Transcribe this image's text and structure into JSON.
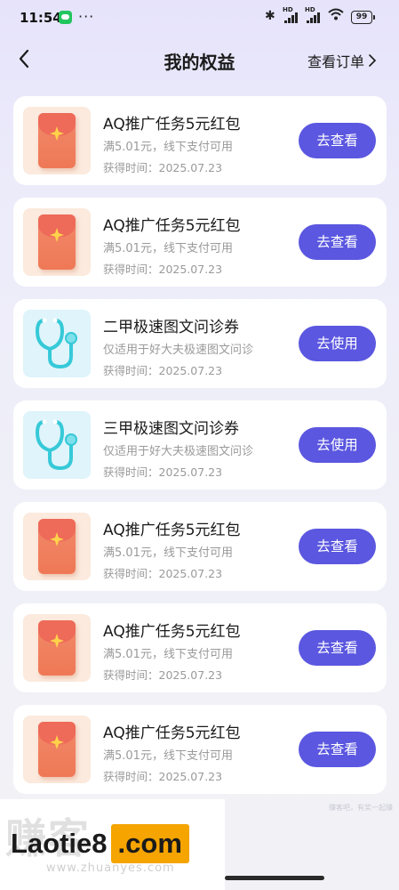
{
  "status_bar": {
    "time": "11:54",
    "dots": "···",
    "hd_label": "HD",
    "battery": "99"
  },
  "header": {
    "title": "我的权益",
    "orders_link": "查看订单"
  },
  "items": [
    {
      "name": "AQ推广任务5元红包",
      "desc": "满5.01元，线下支付可用",
      "date": "获得时间：2025.07.23",
      "button": "去查看",
      "icon": "red-envelope-icon"
    },
    {
      "name": "AQ推广任务5元红包",
      "desc": "满5.01元，线下支付可用",
      "date": "获得时间：2025.07.23",
      "button": "去查看",
      "icon": "red-envelope-icon"
    },
    {
      "name": "二甲极速图文问诊券",
      "desc": "仅适用于好大夫极速图文问诊",
      "date": "获得时间：2025.07.23",
      "button": "去使用",
      "icon": "stethoscope-icon"
    },
    {
      "name": "三甲极速图文问诊券",
      "desc": "仅适用于好大夫极速图文问诊",
      "date": "获得时间：2025.07.23",
      "button": "去使用",
      "icon": "stethoscope-icon"
    },
    {
      "name": "AQ推广任务5元红包",
      "desc": "满5.01元，线下支付可用",
      "date": "获得时间：2025.07.23",
      "button": "去查看",
      "icon": "red-envelope-icon"
    },
    {
      "name": "AQ推广任务5元红包",
      "desc": "满5.01元，线下支付可用",
      "date": "获得时间：2025.07.23",
      "button": "去查看",
      "icon": "red-envelope-icon"
    },
    {
      "name": "AQ推广任务5元红包",
      "desc": "满5.01元，线下支付可用",
      "date": "获得时间：2025.07.23",
      "button": "去查看",
      "icon": "red-envelope-icon"
    }
  ],
  "watermark": {
    "brand": "Laotie8",
    "suffix": ".com",
    "faint_text": "赚客",
    "faint_url": "www.zhuanyes.com",
    "faint_right": "赚客吧，有奖一起赚"
  },
  "colors": {
    "accent": "#5b57e0",
    "card_bg": "#ffffff",
    "envelope": "#ef7856",
    "stethoscope": "#36c9d8",
    "watermark_accent": "#f5a400"
  }
}
